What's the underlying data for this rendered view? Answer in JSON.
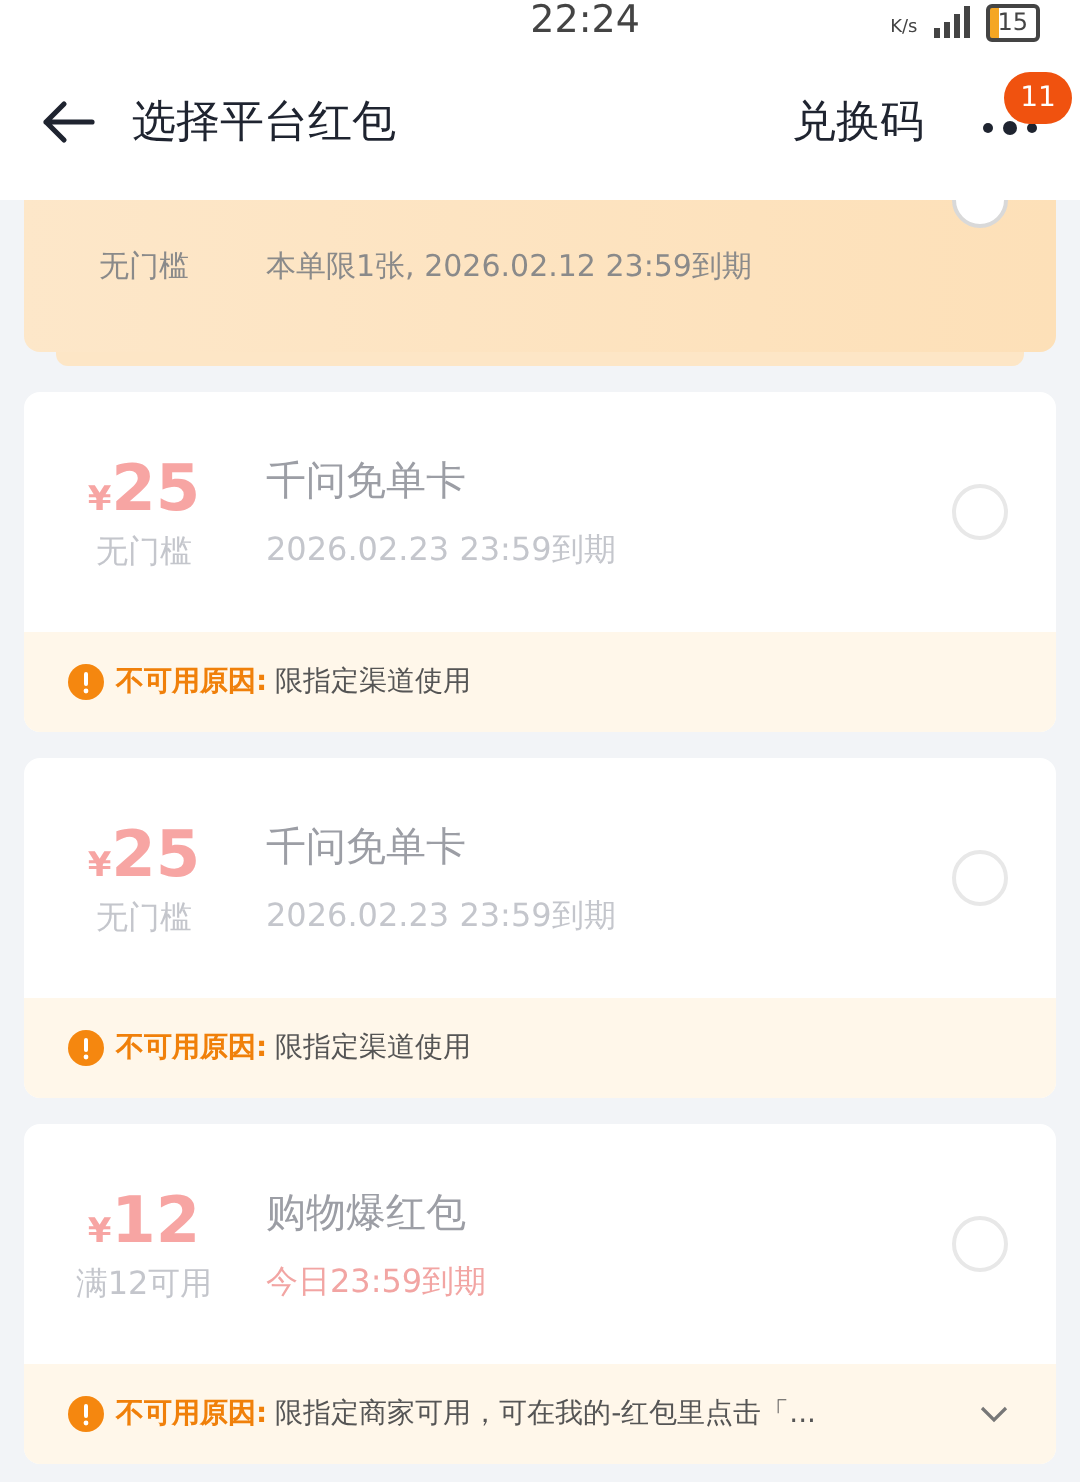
{
  "status_bar": {
    "time": "22:24",
    "net_unit": "K/s",
    "battery": "15"
  },
  "header": {
    "title": "选择平台红包",
    "action": "兑换码",
    "badge": "11"
  },
  "coupons": [
    {
      "kind": "partial",
      "threshold": "无门槛",
      "expiry": "本单限1张, 2026.02.12 23:59到期",
      "selected": false
    },
    {
      "kind": "unavailable",
      "currency": "¥",
      "amount": "25",
      "threshold": "无门槛",
      "title": "千问免单卡",
      "expiry": "2026.02.23 23:59到期",
      "expiry_urgent": false,
      "selected": false,
      "reason_label": "不可用原因:",
      "reason": "限指定渠道使用",
      "expandable": false
    },
    {
      "kind": "unavailable",
      "currency": "¥",
      "amount": "25",
      "threshold": "无门槛",
      "title": "千问免单卡",
      "expiry": "2026.02.23 23:59到期",
      "expiry_urgent": false,
      "selected": false,
      "reason_label": "不可用原因:",
      "reason": "限指定渠道使用",
      "expandable": false
    },
    {
      "kind": "unavailable",
      "currency": "¥",
      "amount": "12",
      "threshold": "满12可用",
      "title": "购物爆红包",
      "expiry": "今日23:59到期",
      "expiry_urgent": true,
      "selected": false,
      "reason_label": "不可用原因:",
      "reason": "限指定商家可用，可在我的-红包里点击「...",
      "expandable": true
    }
  ]
}
